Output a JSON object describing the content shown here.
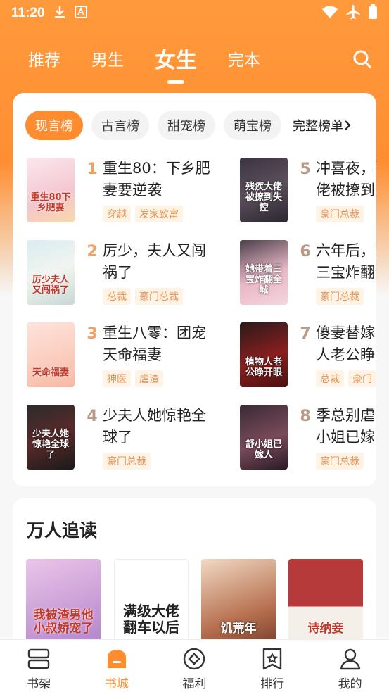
{
  "status_bar": {
    "time": "11:20"
  },
  "top_nav": {
    "tabs": [
      "推荐",
      "男生",
      "女生",
      "完本"
    ],
    "active": "女生"
  },
  "rank_chips": {
    "items": [
      "现言榜",
      "古言榜",
      "甜宠榜",
      "萌宝榜"
    ],
    "more": "完整榜单"
  },
  "books": [
    {
      "rank": "1",
      "title": "重生80：下乡肥妻要逆袭",
      "tags": [
        "穿越",
        "发家致富"
      ],
      "cover_text": "重生80下乡肥妻"
    },
    {
      "rank": "2",
      "title": "厉少，夫人又闯祸了",
      "tags": [
        "总裁",
        "豪门总裁"
      ],
      "cover_text": "厉少夫人又闯祸了"
    },
    {
      "rank": "3",
      "title": "重生八零：团宠天命福妻",
      "tags": [
        "神医",
        "虐渣"
      ],
      "cover_text": "天命福妻"
    },
    {
      "rank": "4",
      "title": "少夫人她惊艳全球了",
      "tags": [
        "豪门总裁"
      ],
      "cover_text": "少夫人她惊艳全球了"
    },
    {
      "rank": "5",
      "title": "冲喜夜，残疾大佬被撩到失控",
      "tags": [
        "豪门总裁"
      ],
      "cover_text": "残疾大佬被撩到失控"
    },
    {
      "rank": "6",
      "title": "六年后，她带着三宝炸翻全城",
      "tags": [
        "豪门总裁"
      ],
      "cover_text": "她带着三宝炸翻全城"
    },
    {
      "rank": "7",
      "title": "傻妻替嫁，植物人老公睁开眼",
      "tags": [
        "总裁",
        "豪门"
      ],
      "cover_text": "植物人老公睁开眼"
    },
    {
      "rank": "8",
      "title": "季总别虐了，舒小姐已嫁人",
      "tags": [
        "豪门总裁"
      ],
      "cover_text": "舒小姐已嫁人"
    }
  ],
  "popular": {
    "title": "万人追读",
    "covers": [
      "我被渣男他小叔娇宠了",
      "满级大佬翻车以后",
      "饥荒年",
      "诗纳妾"
    ]
  },
  "bottom_nav": {
    "items": [
      "书架",
      "书城",
      "福利",
      "排行",
      "我的"
    ],
    "active": "书城"
  },
  "colors": {
    "accent": "#ff8c2e",
    "tag_text": "#e4955a",
    "tag_bg": "#fff3e6"
  }
}
